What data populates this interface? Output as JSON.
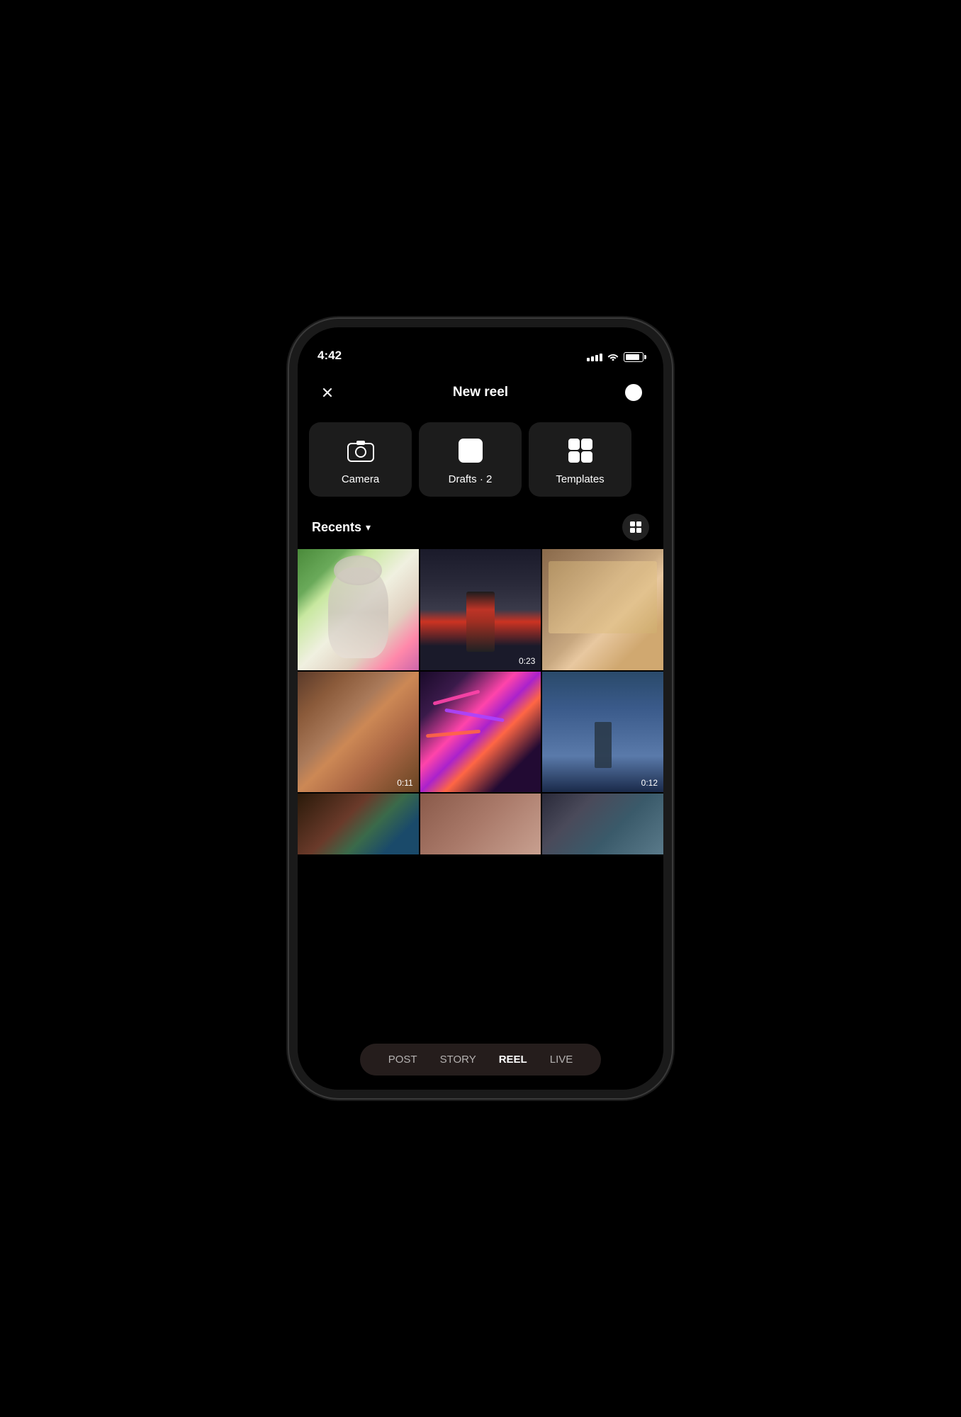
{
  "status_bar": {
    "time": "4:42",
    "signal_bars": [
      3,
      5,
      7,
      9,
      11
    ],
    "wifi": true,
    "battery_pct": 85
  },
  "header": {
    "title": "New reel",
    "close_label": "×",
    "settings_label": "⊙"
  },
  "action_buttons": [
    {
      "id": "camera",
      "label": "Camera",
      "icon": "camera-icon"
    },
    {
      "id": "drafts",
      "label": "Drafts · 2",
      "icon": "drafts-icon"
    },
    {
      "id": "templates",
      "label": "Templates",
      "icon": "templates-icon"
    }
  ],
  "recents": {
    "label": "Recents",
    "chevron": "▾"
  },
  "grid": {
    "rows": [
      [
        {
          "id": "cell-alien",
          "duration": null
        },
        {
          "id": "cell-person-dark",
          "duration": "0:23"
        },
        {
          "id": "cell-japanese-room",
          "duration": null
        }
      ],
      [
        {
          "id": "cell-couple",
          "duration": "0:11"
        },
        {
          "id": "cell-synth",
          "duration": null
        },
        {
          "id": "cell-person-blue",
          "duration": "0:12"
        }
      ],
      [
        {
          "id": "cell-art",
          "duration": null
        },
        {
          "id": "cell-gradient-pink",
          "duration": null
        },
        {
          "id": "cell-seafood",
          "duration": null
        }
      ]
    ]
  },
  "bottom_nav": {
    "items": [
      {
        "id": "post",
        "label": "POST",
        "active": false
      },
      {
        "id": "story",
        "label": "STORY",
        "active": false
      },
      {
        "id": "reel",
        "label": "REEL",
        "active": true
      },
      {
        "id": "live",
        "label": "LIVE",
        "active": false
      }
    ]
  }
}
